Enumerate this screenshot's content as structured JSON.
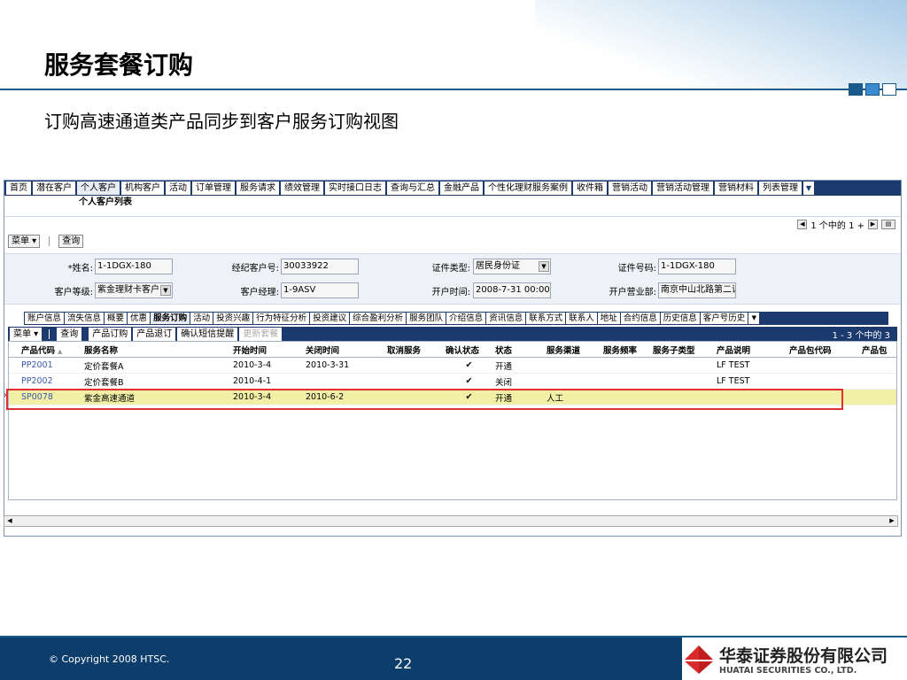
{
  "slide": {
    "title": "服务套餐订购",
    "subtitle": "订购高速通道类产品同步到客户服务订购视图",
    "copyright": "© Copyright 2008 HTSC.",
    "page_number": "22",
    "logo_cn": "华泰证券股份有限公司",
    "logo_en": "HUATAI SECURITIES CO., LTD.",
    "highlight_color": "#e03030"
  },
  "topnav": {
    "tabs": [
      "首页",
      "潜在客户",
      "个人客户",
      "机构客户",
      "活动",
      "订单管理",
      "服务请求",
      "绩效管理",
      "实时接口日志",
      "查询与汇总",
      "金融产品",
      "个性化理财服务案例",
      "收件箱",
      "营销活动",
      "营销活动管理",
      "营销材料",
      "列表管理"
    ],
    "active_index": 2,
    "more_icon": "▼"
  },
  "subnav": {
    "label": "个人客户列表"
  },
  "pager_top": {
    "text": "1 个中的 1 +"
  },
  "form_toolbar": {
    "menu": "菜单 ▾",
    "query": "查询"
  },
  "form": {
    "name_label": "*姓名:",
    "name_value": "1-1DGX-180",
    "agent_label": "经纪客户号:",
    "agent_value": "30033922",
    "cert_type_label": "证件类型:",
    "cert_type_value": "居民身份证",
    "cert_no_label": "证件号码:",
    "cert_no_value": "1-1DGX-180",
    "level_label": "客户等级:",
    "level_value": "紫金理财卡客户",
    "manager_label": "客户经理:",
    "manager_value": "1-9ASV",
    "open_time_label": "开户时间:",
    "open_time_value": "2008-7-31 00:00",
    "branch_label": "开户营业部:",
    "branch_value": "南京中山北路第二证"
  },
  "subtabs": {
    "tabs": [
      "账户信息",
      "流失信息",
      "概要",
      "优惠",
      "服务订购",
      "活动",
      "投资兴趣",
      "行为特征分析",
      "投资建议",
      "综合盈利分析",
      "服务团队",
      "介绍信息",
      "资讯信息",
      "联系方式",
      "联系人",
      "地址",
      "合约信息",
      "历史信息",
      "客户号历史"
    ],
    "active_index": 4,
    "more_icon": "▼"
  },
  "grid_toolbar": {
    "menu": "菜单 ▾",
    "query": "查询",
    "buy": "产品订购",
    "unsubscribe": "产品退订",
    "confirm_sms": "确认短信提醒",
    "update": "更新套餐",
    "pager": "1 - 3 个中的 3"
  },
  "grid": {
    "columns": [
      "产品代码",
      "服务名称",
      "开始时间",
      "关闭时间",
      "取消服务",
      "确认状态",
      "状态",
      "服务渠道",
      "服务频率",
      "服务子类型",
      "产品说明",
      "产品包代码",
      "产品包"
    ],
    "sort_icon": "▲",
    "rows": [
      {
        "code": "PP2001",
        "name": "定价套餐A",
        "start": "2010-3-4",
        "end": "2010-3-31",
        "cancel": "",
        "confirm": "✔",
        "status": "开通",
        "channel": "",
        "freq": "",
        "subtype": "",
        "desc": "LF TEST",
        "pkg": "",
        "pkg2": ""
      },
      {
        "code": "PP2002",
        "name": "定价套餐B",
        "start": "2010-4-1",
        "end": "",
        "cancel": "",
        "confirm": "✔",
        "status": "关闭",
        "channel": "",
        "freq": "",
        "subtype": "",
        "desc": "LF TEST",
        "pkg": "",
        "pkg2": ""
      },
      {
        "code": "SP0078",
        "name": "紫金高速通道",
        "start": "2010-3-4",
        "end": "2010-6-2",
        "cancel": "",
        "confirm": "✔",
        "status": "开通",
        "channel": "人工",
        "freq": "",
        "subtype": "",
        "desc": "",
        "pkg": "",
        "pkg2": ""
      }
    ],
    "selected_index": 2
  }
}
